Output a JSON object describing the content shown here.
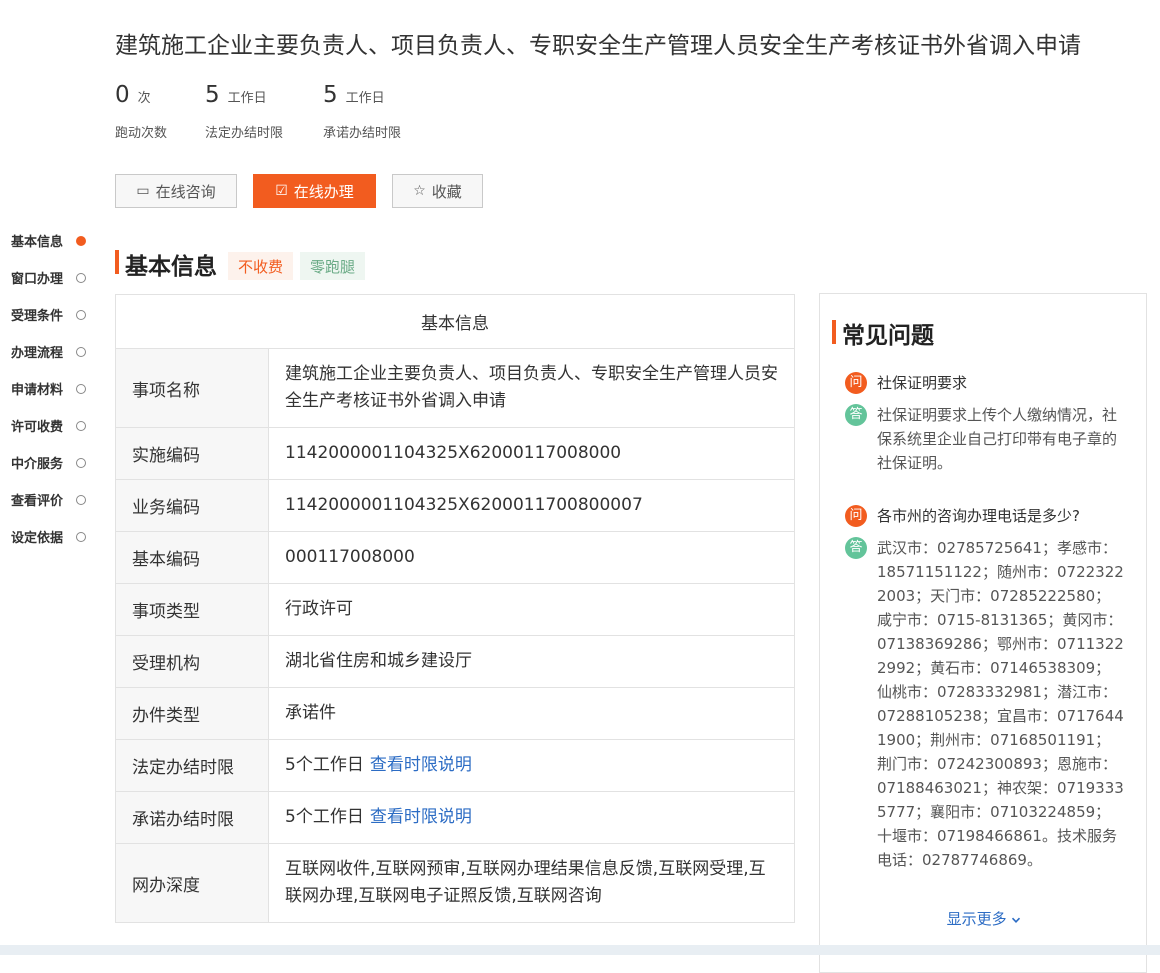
{
  "title": "建筑施工企业主要负责人、项目负责人、专职安全生产管理人员安全生产考核证书外省调入申请",
  "stats": [
    {
      "value": "0",
      "unit": "次",
      "label": "跑动次数"
    },
    {
      "value": "5",
      "unit": "工作日",
      "label": "法定办结时限"
    },
    {
      "value": "5",
      "unit": "工作日",
      "label": "承诺办结时限"
    }
  ],
  "actions": {
    "consult": "在线咨询",
    "handle": "在线办理",
    "favorite": "收藏"
  },
  "side_nav": {
    "items": [
      "基本信息",
      "窗口办理",
      "受理条件",
      "办理流程",
      "申请材料",
      "许可收费",
      "中介服务",
      "查看评价",
      "设定依据"
    ],
    "active_index": 0
  },
  "section": {
    "title": "基本信息",
    "tag_fee": "不收费",
    "tag_zero": "零跑腿"
  },
  "info_table": {
    "header": "基本信息",
    "rows": [
      {
        "key": "事项名称",
        "value": "建筑施工企业主要负责人、项目负责人、专职安全生产管理人员安全生产考核证书外省调入申请"
      },
      {
        "key": "实施编码",
        "value": "1142000001104325X62000117008000"
      },
      {
        "key": "业务编码",
        "value": "1142000001104325X6200011700800007"
      },
      {
        "key": "基本编码",
        "value": "000117008000"
      },
      {
        "key": "事项类型",
        "value": "行政许可"
      },
      {
        "key": "受理机构",
        "value": "湖北省住房和城乡建设厅"
      },
      {
        "key": "办件类型",
        "value": "承诺件"
      },
      {
        "key": "法定办结时限",
        "value": "5个工作日",
        "link": "查看时限说明"
      },
      {
        "key": "承诺办结时限",
        "value": "5个工作日",
        "link": "查看时限说明"
      },
      {
        "key": "网办深度",
        "value": "互联网收件,互联网预审,互联网办理结果信息反馈,互联网受理,互联网办理,互联网电子证照反馈,互联网咨询"
      }
    ]
  },
  "faq": {
    "title": "常见问题",
    "q_badge": "问",
    "a_badge": "答",
    "items": [
      {
        "q": "社保证明要求",
        "a": "社保证明要求上传个人缴纳情况，社保系统里企业自己打印带有电子章的社保证明。"
      },
      {
        "q": "各市州的咨询办理电话是多少?",
        "a": "武汉市：02785725641；孝感市：18571151122；随州市：07223222003；天门市：07285222580；咸宁市：0715-8131365；黄冈市：07138369286；鄂州市：07113222992；黄石市：07146538309；仙桃市：07283332981；潜江市：07288105238；宜昌市：07176441900；荆州市：07168501191；荆门市：07242300893；恩施市：07188463021；神农架：07193335777；襄阳市：07103224859；十堰市：07198466861。技术服务电话：02787746869。"
      }
    ],
    "more": "显示更多",
    "more_icon": "chevron-down-icon"
  },
  "colors": {
    "accent": "#f25c1f",
    "answer": "#63c49a",
    "link": "#2c6cc4"
  }
}
